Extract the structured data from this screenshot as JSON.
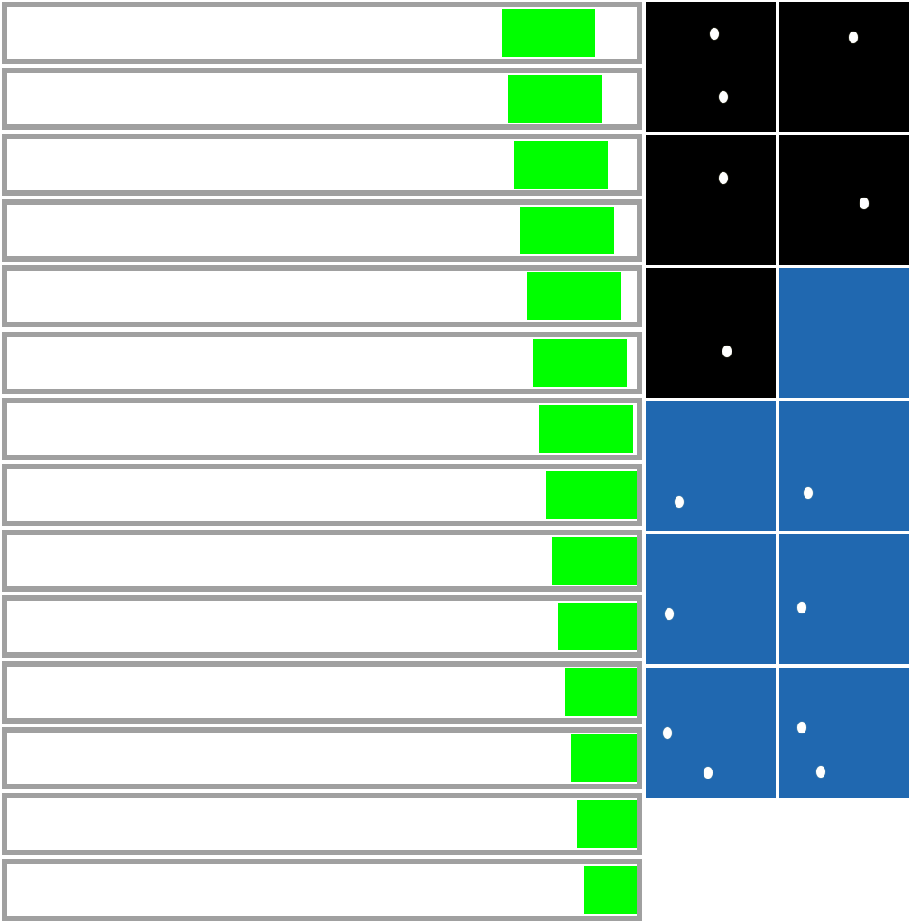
{
  "colors": {
    "frame": "#a0a0a0",
    "fill": "#00ff00",
    "track": "#ffffff",
    "tile_black": "#000000",
    "tile_blue": "#2068b0",
    "dot": "#ffffff"
  },
  "bars": [
    {
      "start": 0.7857,
      "end": 0.9343
    },
    {
      "start": 0.7957,
      "end": 0.9443
    },
    {
      "start": 0.8057,
      "end": 0.9543
    },
    {
      "start": 0.8157,
      "end": 0.9643
    },
    {
      "start": 0.8257,
      "end": 0.9743
    },
    {
      "start": 0.8357,
      "end": 0.9843
    },
    {
      "start": 0.8457,
      "end": 0.9943
    },
    {
      "start": 0.8557,
      "end": 1.0
    },
    {
      "start": 0.8657,
      "end": 1.0
    },
    {
      "start": 0.8757,
      "end": 1.0
    },
    {
      "start": 0.8857,
      "end": 1.0
    },
    {
      "start": 0.8957,
      "end": 1.0
    },
    {
      "start": 0.9057,
      "end": 1.0
    },
    {
      "start": 0.9157,
      "end": 1.0
    }
  ],
  "tiles": [
    {
      "color": "black",
      "dots": 2
    },
    {
      "color": "black",
      "dots": 1
    },
    {
      "color": "black",
      "dots": 1
    },
    {
      "color": "black",
      "dots": 1
    },
    {
      "color": "black",
      "dots": 1
    },
    {
      "color": "blue",
      "dots": 0
    },
    {
      "color": "blue",
      "dots": 1
    },
    {
      "color": "blue",
      "dots": 1
    },
    {
      "color": "blue",
      "dots": 1
    },
    {
      "color": "blue",
      "dots": 1
    },
    {
      "color": "blue",
      "dots": 2
    },
    {
      "color": "blue",
      "dots": 2
    }
  ]
}
